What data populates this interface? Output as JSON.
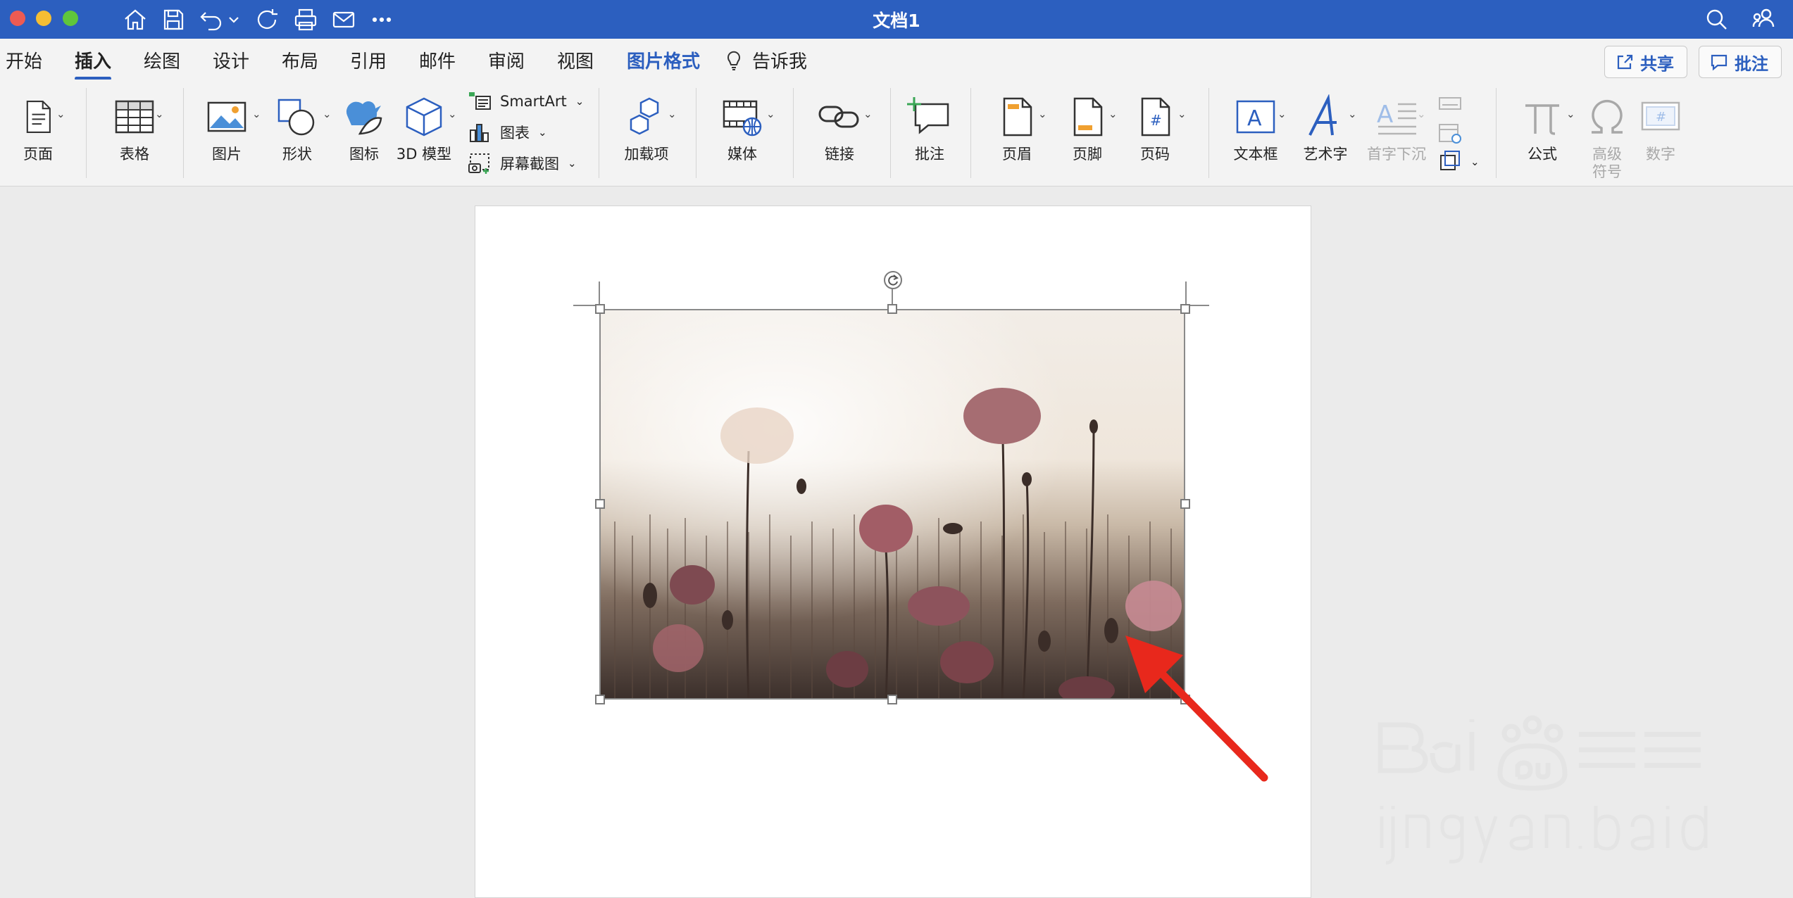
{
  "window": {
    "title": "文档1"
  },
  "titlebar_icons": [
    "home-icon",
    "save-icon",
    "undo-icon",
    "redo-icon",
    "print-icon",
    "mail-icon",
    "more-icon",
    "search-icon",
    "account-icon"
  ],
  "tabs": [
    {
      "label": "开始"
    },
    {
      "label": "插入"
    },
    {
      "label": "绘图"
    },
    {
      "label": "设计"
    },
    {
      "label": "布局"
    },
    {
      "label": "引用"
    },
    {
      "label": "邮件"
    },
    {
      "label": "审阅"
    },
    {
      "label": "视图"
    },
    {
      "label": "图片格式"
    }
  ],
  "tell_me": {
    "label": "告诉我"
  },
  "share_button": {
    "label": "共享"
  },
  "comments_button": {
    "label": "批注"
  },
  "ribbon": {
    "page": "页面",
    "table": "表格",
    "picture": "图片",
    "shapes": "形状",
    "icons": "图标",
    "model3d": "3D 模型",
    "smartart": "SmartArt",
    "chart": "图表",
    "screenshot": "屏幕截图",
    "addins": "加载项",
    "media": "媒体",
    "link": "链接",
    "comment": "批注",
    "header": "页眉",
    "footer": "页脚",
    "page_number": "页码",
    "textbox": "文本框",
    "wordart": "艺术字",
    "dropcap": "首字下沉",
    "equation": "公式",
    "symbol_line1": "高级",
    "symbol_line2": "符号",
    "number": "数字"
  },
  "colors": {
    "accent": "#2c5fbf",
    "arrow": "#e8281c"
  }
}
